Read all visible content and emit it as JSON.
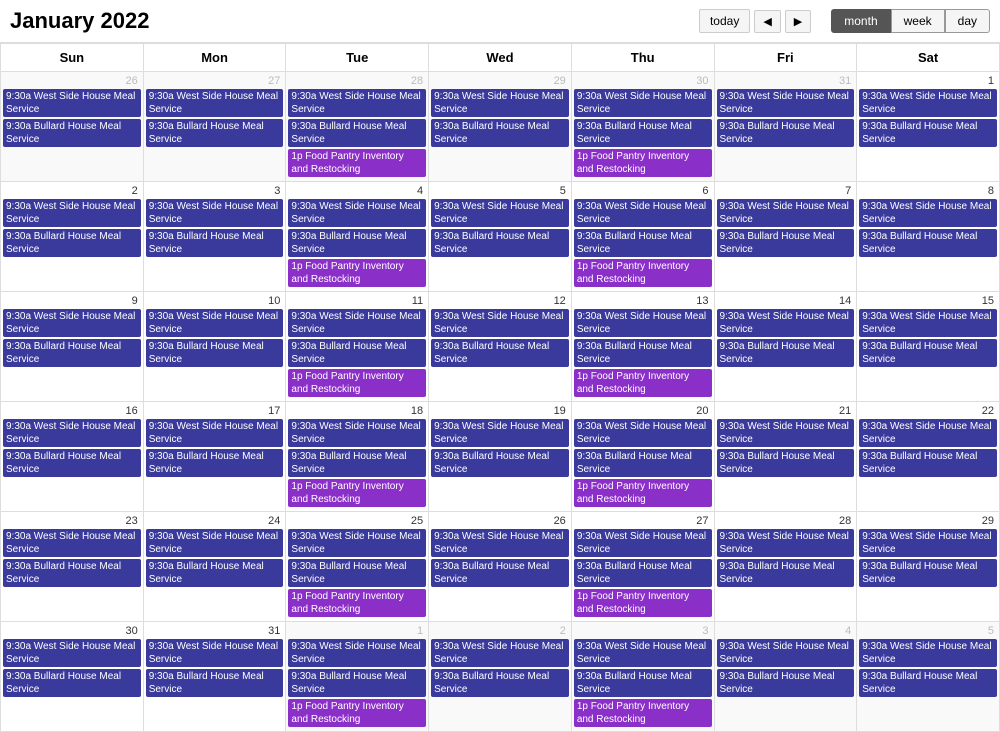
{
  "header": {
    "title": "January 2022",
    "today_label": "today",
    "prev_icon": "◄",
    "next_icon": "►",
    "view_month": "month",
    "view_week": "week",
    "view_day": "day"
  },
  "weekdays": [
    "Sun",
    "Mon",
    "Tue",
    "Wed",
    "Thu",
    "Fri",
    "Sat"
  ],
  "events": {
    "west_side": "9:30a West Side House Meal Service",
    "bullard": "9:30a Bullard House Meal Service",
    "food_pantry": "1p Food Pantry Inventory and Restocking"
  },
  "weeks": [
    {
      "days": [
        {
          "num": "26",
          "other": true,
          "west": true,
          "bullard": true,
          "pantry": false
        },
        {
          "num": "27",
          "other": true,
          "west": true,
          "bullard": true,
          "pantry": false
        },
        {
          "num": "28",
          "other": true,
          "west": true,
          "bullard": true,
          "pantry": true
        },
        {
          "num": "29",
          "other": true,
          "west": true,
          "bullard": true,
          "pantry": false
        },
        {
          "num": "30",
          "other": true,
          "west": true,
          "bullard": true,
          "pantry": true
        },
        {
          "num": "31",
          "other": true,
          "west": true,
          "bullard": true,
          "pantry": false
        },
        {
          "num": "1",
          "other": false,
          "west": true,
          "bullard": true,
          "pantry": false
        }
      ]
    },
    {
      "days": [
        {
          "num": "2",
          "other": false,
          "west": true,
          "bullard": true,
          "pantry": false
        },
        {
          "num": "3",
          "other": false,
          "west": true,
          "bullard": true,
          "pantry": false
        },
        {
          "num": "4",
          "other": false,
          "west": true,
          "bullard": true,
          "pantry": true
        },
        {
          "num": "5",
          "other": false,
          "west": true,
          "bullard": true,
          "pantry": false
        },
        {
          "num": "6",
          "other": false,
          "west": true,
          "bullard": true,
          "pantry": true
        },
        {
          "num": "7",
          "other": false,
          "west": true,
          "bullard": true,
          "pantry": false
        },
        {
          "num": "8",
          "other": false,
          "west": true,
          "bullard": true,
          "pantry": false
        }
      ]
    },
    {
      "days": [
        {
          "num": "9",
          "other": false,
          "west": true,
          "bullard": true,
          "pantry": false
        },
        {
          "num": "10",
          "other": false,
          "west": true,
          "bullard": true,
          "pantry": false
        },
        {
          "num": "11",
          "other": false,
          "west": true,
          "bullard": true,
          "pantry": true
        },
        {
          "num": "12",
          "other": false,
          "west": true,
          "bullard": true,
          "pantry": false
        },
        {
          "num": "13",
          "other": false,
          "west": true,
          "bullard": true,
          "pantry": true
        },
        {
          "num": "14",
          "other": false,
          "west": true,
          "bullard": true,
          "pantry": false
        },
        {
          "num": "15",
          "other": false,
          "west": true,
          "bullard": true,
          "pantry": false
        }
      ]
    },
    {
      "days": [
        {
          "num": "16",
          "other": false,
          "west": true,
          "bullard": true,
          "pantry": false
        },
        {
          "num": "17",
          "other": false,
          "west": true,
          "bullard": true,
          "pantry": false
        },
        {
          "num": "18",
          "other": false,
          "west": true,
          "bullard": true,
          "pantry": true
        },
        {
          "num": "19",
          "other": false,
          "west": true,
          "bullard": true,
          "pantry": false
        },
        {
          "num": "20",
          "other": false,
          "west": true,
          "bullard": true,
          "pantry": true
        },
        {
          "num": "21",
          "other": false,
          "west": true,
          "bullard": true,
          "pantry": false
        },
        {
          "num": "22",
          "other": false,
          "west": true,
          "bullard": true,
          "pantry": false
        }
      ]
    },
    {
      "days": [
        {
          "num": "23",
          "other": false,
          "west": true,
          "bullard": true,
          "pantry": false
        },
        {
          "num": "24",
          "other": false,
          "west": true,
          "bullard": true,
          "pantry": false
        },
        {
          "num": "25",
          "other": false,
          "west": true,
          "bullard": true,
          "pantry": true
        },
        {
          "num": "26",
          "other": false,
          "west": true,
          "bullard": true,
          "pantry": false
        },
        {
          "num": "27",
          "other": false,
          "west": true,
          "bullard": true,
          "pantry": true
        },
        {
          "num": "28",
          "other": false,
          "west": true,
          "bullard": true,
          "pantry": false
        },
        {
          "num": "29",
          "other": false,
          "west": true,
          "bullard": true,
          "pantry": false
        }
      ]
    },
    {
      "days": [
        {
          "num": "30",
          "other": false,
          "west": true,
          "bullard": true,
          "pantry": false
        },
        {
          "num": "31",
          "other": false,
          "west": true,
          "bullard": true,
          "pantry": false
        },
        {
          "num": "1",
          "other": true,
          "west": true,
          "bullard": true,
          "pantry": true
        },
        {
          "num": "2",
          "other": true,
          "west": true,
          "bullard": true,
          "pantry": false
        },
        {
          "num": "3",
          "other": true,
          "west": true,
          "bullard": true,
          "pantry": true
        },
        {
          "num": "4",
          "other": true,
          "west": true,
          "bullard": true,
          "pantry": false
        },
        {
          "num": "5",
          "other": true,
          "west": true,
          "bullard": true,
          "pantry": false
        }
      ]
    }
  ]
}
